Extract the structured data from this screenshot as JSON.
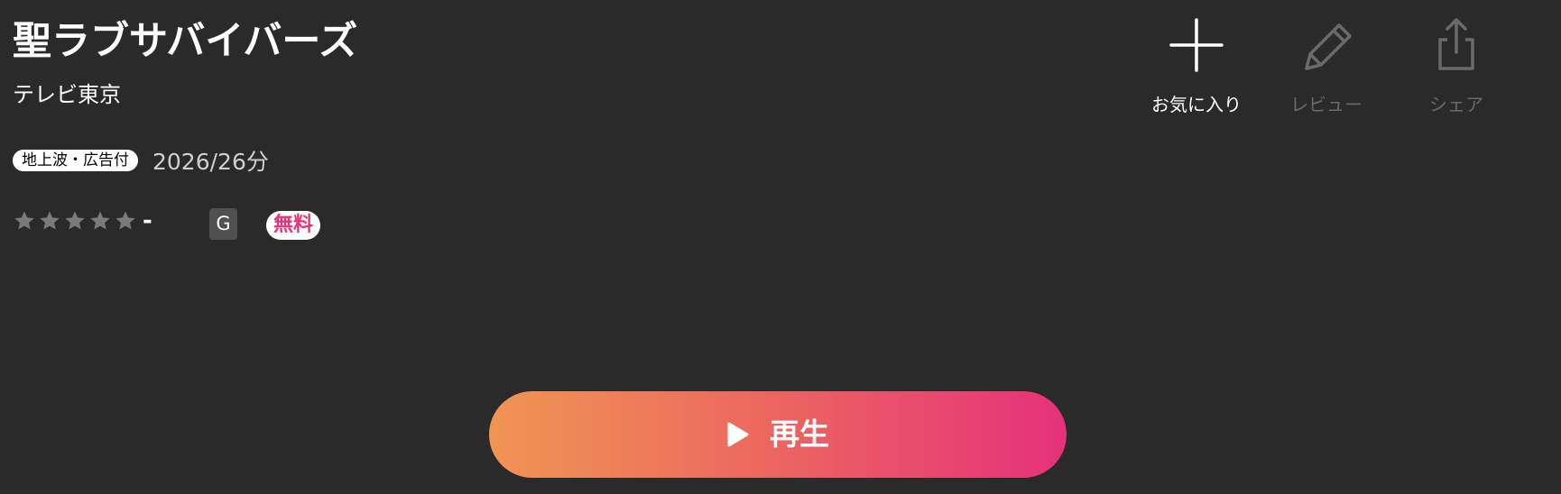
{
  "program": {
    "title": "聖ラブサバイバーズ",
    "channel": "テレビ東京",
    "broadcast_badge": "地上波・広告付",
    "meta": "2026/26分"
  },
  "rating": {
    "stars_total": 5,
    "stars_filled": 0,
    "value": "-",
    "age_rating": "G",
    "price_badge": "無料"
  },
  "actions": {
    "favorite_label": "お気に入り",
    "review_label": "レビュー",
    "share_label": "シェア"
  },
  "play": {
    "label": "再生"
  },
  "colors": {
    "background": "#2a2a2a",
    "free_badge_text": "#e8337a",
    "play_gradient_start": "#f09552",
    "play_gradient_end": "#e5317a",
    "disabled_action": "#6a6a6a",
    "star_empty": "#7a7a7a"
  },
  "icons": {
    "favorite": "plus-icon",
    "review": "pencil-icon",
    "share": "share-icon",
    "play": "play-icon",
    "star": "star-icon"
  }
}
